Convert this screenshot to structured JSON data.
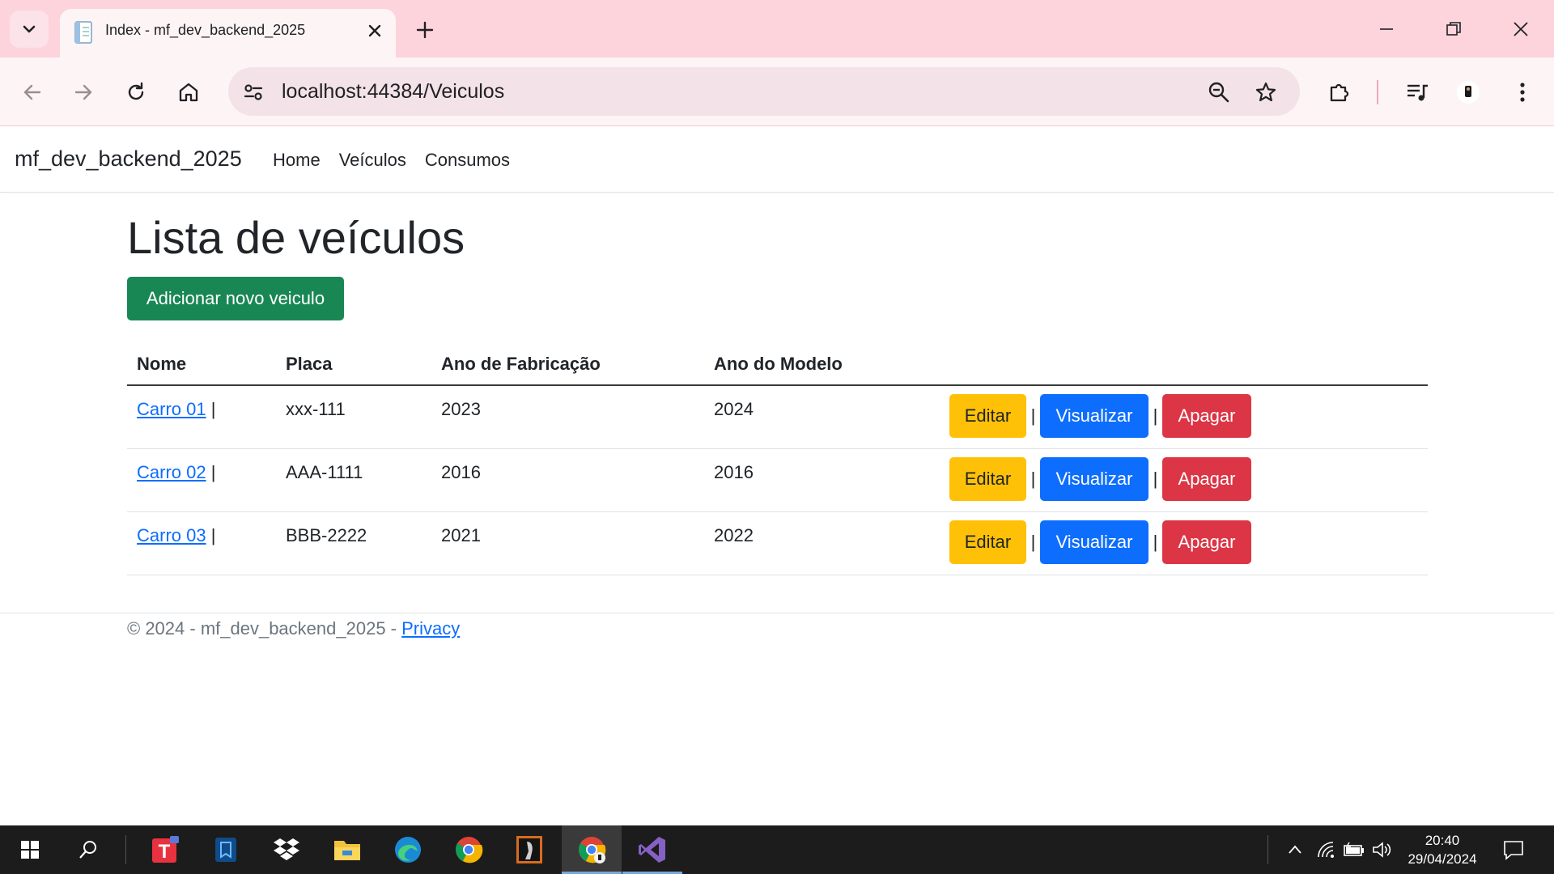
{
  "browser": {
    "tab_title": "Index - mf_dev_backend_2025",
    "url_host": "localhost",
    "url_rest": ":44384/Veiculos"
  },
  "navbar": {
    "brand": "mf_dev_backend_2025",
    "links": [
      "Home",
      "Veículos",
      "Consumos"
    ]
  },
  "main": {
    "title": "Lista de veículos",
    "add_button": "Adicionar novo veiculo",
    "table": {
      "headers": [
        "Nome",
        "Placa",
        "Ano de Fabricação",
        "Ano do Modelo"
      ],
      "rows": [
        {
          "nome": "Carro 01",
          "placa": "xxx-111",
          "ano_fabricacao": "2023",
          "ano_modelo": "2024"
        },
        {
          "nome": "Carro 02",
          "placa": "AAA-1111",
          "ano_fabricacao": "2016",
          "ano_modelo": "2016"
        },
        {
          "nome": "Carro 03",
          "placa": "BBB-2222",
          "ano_fabricacao": "2021",
          "ano_modelo": "2022"
        }
      ],
      "separator": "|",
      "actions": {
        "edit": "Editar",
        "view": "Visualizar",
        "delete": "Apagar"
      }
    }
  },
  "footer": {
    "text": "© 2024 - mf_dev_backend_2025 - ",
    "privacy_link": "Privacy"
  },
  "taskbar": {
    "time": "20:40",
    "date": "29/04/2024",
    "apps": [
      "start-icon",
      "search-icon",
      "typora-icon",
      "notes-icon",
      "dropbox-icon",
      "file-explorer-icon",
      "edge-icon",
      "chrome-icon",
      "media-icon",
      "chrome-profile-icon",
      "visual-studio-icon"
    ]
  },
  "colors": {
    "tabstrip": "#fdd3dc",
    "toolbar": "#fdf4f6",
    "success": "#198754",
    "warning": "#ffc107",
    "primary": "#0d6efd",
    "danger": "#dc3545"
  }
}
